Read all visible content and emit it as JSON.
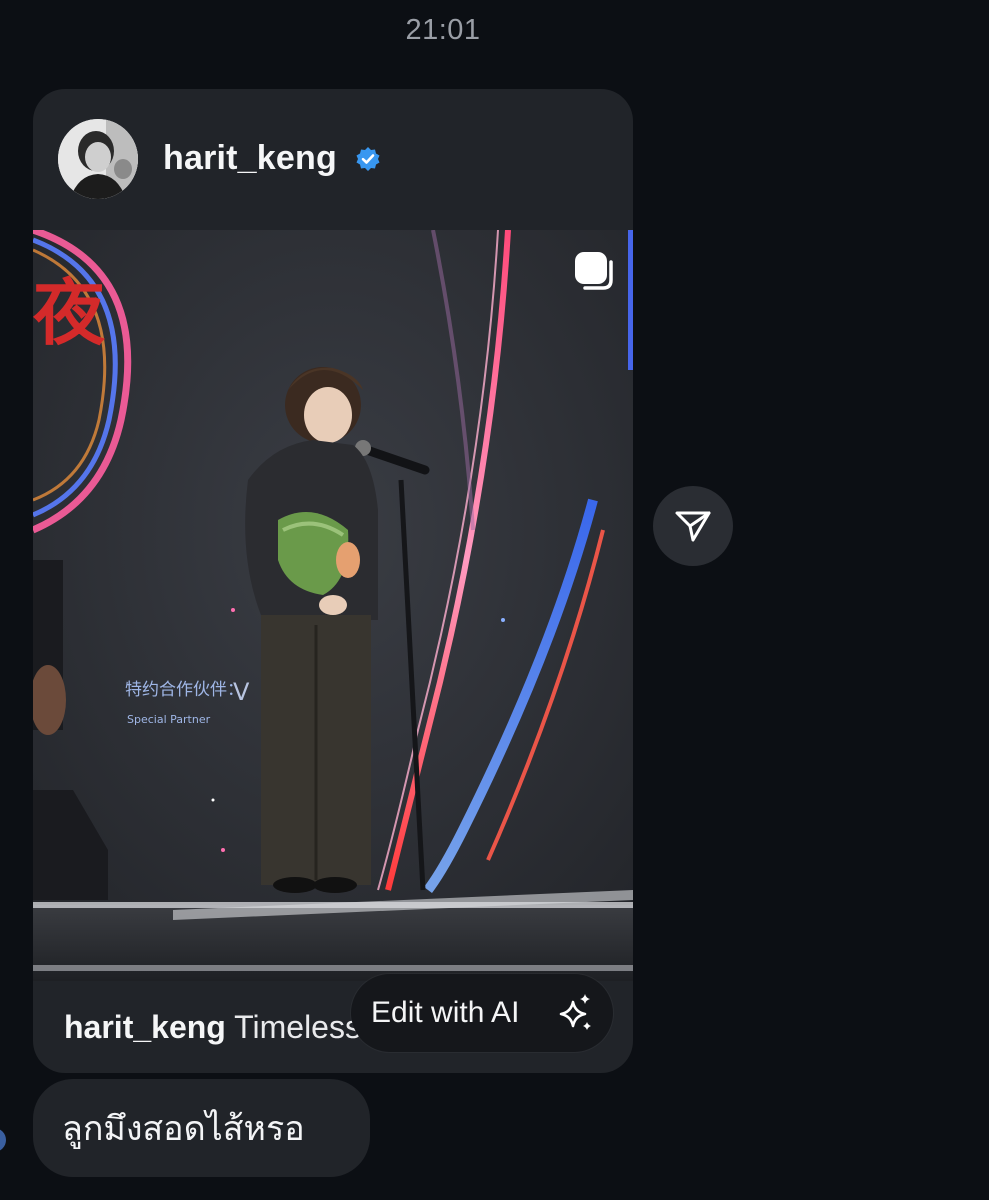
{
  "chat": {
    "timestamp": "21:01"
  },
  "post": {
    "username": "harit_keng",
    "verified": true,
    "caption_username": "harit_keng",
    "caption_text": "Timeless .",
    "media_type": "carousel",
    "stage_sign": {
      "chinese": "特约合作伙伴：",
      "english": "Special Partner",
      "big_char": "夜"
    },
    "edit_ai_label": "Edit with AI"
  },
  "reply": {
    "text": "ลูกมึงสอดไส้หรอ"
  },
  "icons": {
    "verified": "verified-badge-icon",
    "carousel": "carousel-icon",
    "share": "send-icon",
    "sparkle": "sparkle-icon"
  },
  "colors": {
    "background": "#0c0f14",
    "bubble": "#212429",
    "verified": "#3897f0",
    "timestamp": "#9a9ea6"
  }
}
